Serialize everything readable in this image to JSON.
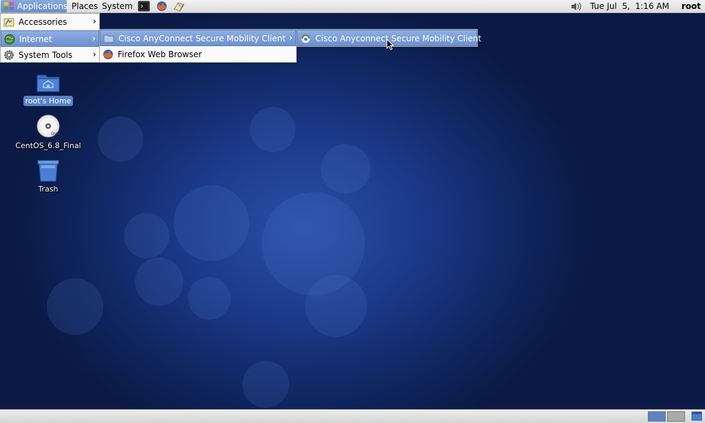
{
  "top_panel": {
    "menus": {
      "applications": "Applications",
      "places": "Places",
      "system": "System"
    },
    "launchers": [
      "terminal-icon",
      "firefox-icon",
      "text-editor-icon"
    ],
    "clock": "Tue Jul  5,  1:16 AM",
    "user": "root"
  },
  "applications_menu": {
    "items": [
      {
        "label": "Accessories",
        "icon": "accessories-icon",
        "has_submenu": true
      },
      {
        "label": "Internet",
        "icon": "globe-icon",
        "has_submenu": true,
        "highlighted": true
      },
      {
        "label": "System Tools",
        "icon": "gear-icon",
        "has_submenu": true
      }
    ]
  },
  "internet_submenu": {
    "items": [
      {
        "label": "Cisco AnyConnect Secure Mobility Client",
        "icon": "folder-icon",
        "has_submenu": true,
        "highlighted": true
      },
      {
        "label": "Firefox Web Browser",
        "icon": "firefox-icon",
        "has_submenu": false
      }
    ]
  },
  "cisco_submenu": {
    "items": [
      {
        "label": "Cisco Anyconnect Secure Mobility Client",
        "icon": "cisco-anyconnect-icon",
        "highlighted": true
      }
    ]
  },
  "desktop_icons": [
    {
      "label": "root's Home",
      "icon": "home-folder-icon",
      "selected": true
    },
    {
      "label": "CentOS_6.8_Final",
      "icon": "dvd-icon",
      "selected": false
    },
    {
      "label": "Trash",
      "icon": "trash-icon",
      "selected": false
    }
  ],
  "bottom_panel": {
    "workspaces": 2,
    "active_workspace": 1
  },
  "colors": {
    "highlight": "#6d91cf",
    "desktop": "#1c3a8a"
  }
}
